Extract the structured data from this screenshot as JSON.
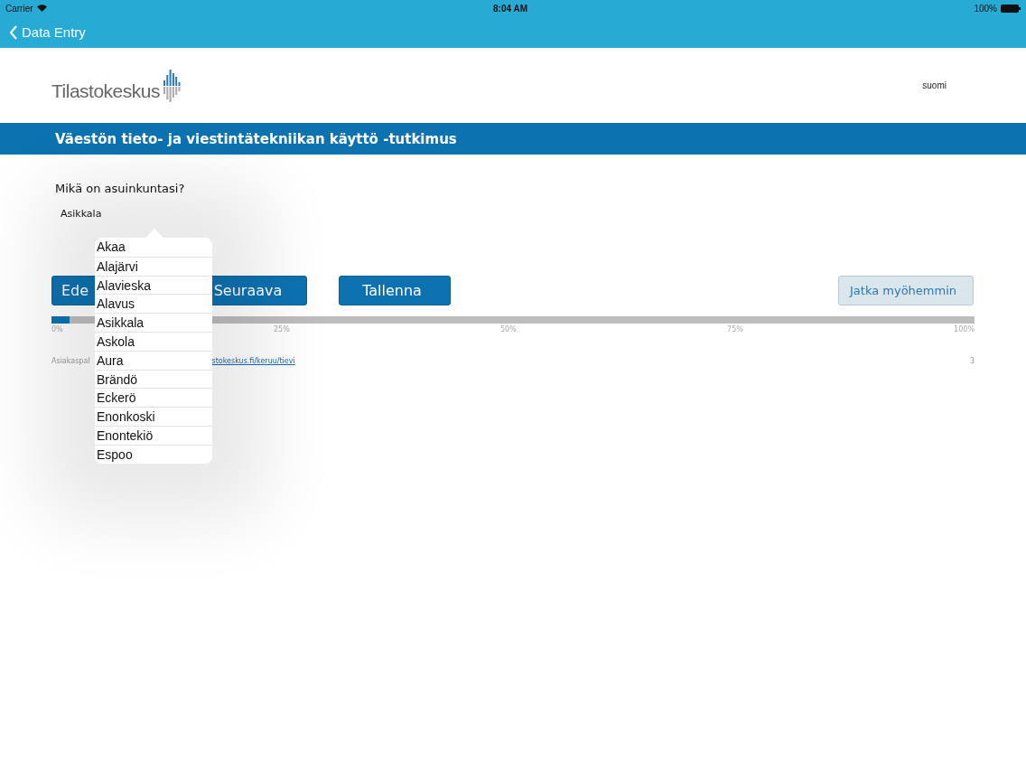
{
  "status_bar": {
    "carrier": "Carrier",
    "time": "8:04 AM",
    "battery": "100%"
  },
  "nav": {
    "back": "Data Entry"
  },
  "header": {
    "logo": "Tilastokeskus",
    "language": "suomi"
  },
  "title": "Väestön tieto- ja viestintätekniikan käyttö -tutkimus",
  "question": "Mikä on asuinkuntasi?",
  "answer": "Asikkala",
  "buttons": [
    {
      "label": "Ede",
      "kind": "primary"
    },
    {
      "label": "Seuraava",
      "kind": "primary"
    },
    {
      "label": "Tallenna",
      "kind": "primary"
    },
    {
      "label": "Jatka myöhemmin",
      "kind": "secondary"
    }
  ],
  "progress": {
    "level": 0.02,
    "ticks": [
      "0%",
      "25%",
      "50%",
      "75%",
      "100%"
    ]
  },
  "footer": {
    "text": "Asiakaspal",
    "link": "stokeskus.fi/keruu/tievi",
    "page": "3"
  },
  "picker": {
    "options": [
      "Akaa",
      "Alajärvi",
      "Alavieska",
      "Alavus",
      "Asikkala",
      "Askola",
      "Aura",
      "Brändö",
      "Eckerö",
      "Enonkoski",
      "Enontekiö",
      "Espoo"
    ]
  }
}
